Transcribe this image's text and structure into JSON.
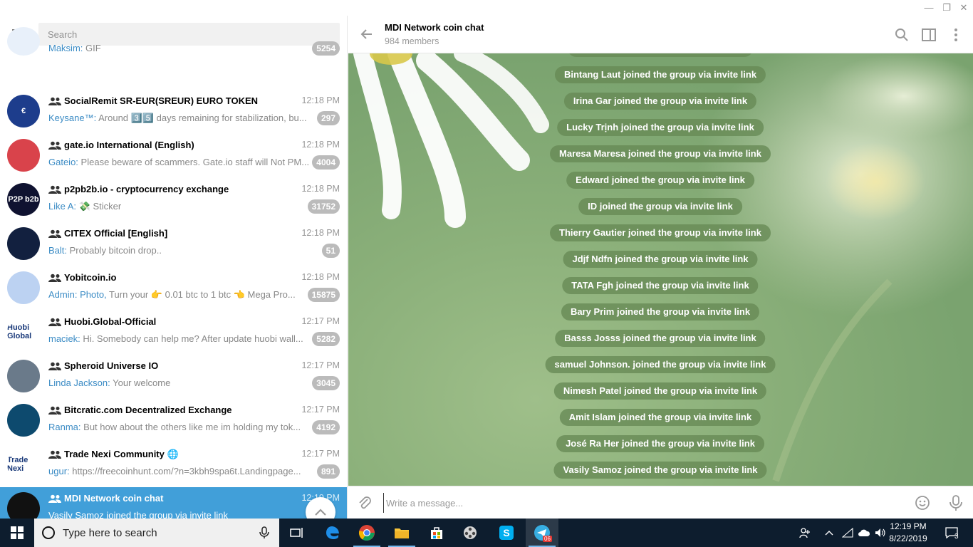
{
  "window": {
    "minimize": "—",
    "maximize": "❐",
    "close": "✕"
  },
  "sidebar": {
    "search_placeholder": "Search",
    "chats": [
      {
        "name": "",
        "sender": "Maksim:",
        "text": "GIF",
        "time": "",
        "badge": "5254",
        "avatar_color": "#e8f0fa",
        "avatar_text": "",
        "group": false
      },
      {
        "name": "SocialRemit SR-EUR(SREUR) EURO TOKEN",
        "sender": "Keysane™:",
        "text": "Around 3️⃣5️⃣ days remaining for stabilization, bu...",
        "time": "12:18 PM",
        "badge": "297",
        "avatar_color": "#1d3d8c",
        "avatar_text": "€",
        "group": true
      },
      {
        "name": "gate.io International (English)",
        "sender": "Gateio:",
        "text": "Please beware of scammers. Gate.io staff will Not PM...",
        "time": "12:18 PM",
        "badge": "4004",
        "avatar_color": "#d9434b",
        "avatar_text": "",
        "group": true
      },
      {
        "name": "p2pb2b.io - cryptocurrency exchange",
        "sender": "Like A:",
        "text": "💸 Sticker",
        "time": "12:18 PM",
        "badge": "31752",
        "avatar_color": "#0f1230",
        "avatar_text": "P2P b2b",
        "group": true
      },
      {
        "name": "CITEX Official [English]",
        "sender": "Balt:",
        "text": "Probably bitcoin drop..",
        "time": "12:18 PM",
        "badge": "51",
        "avatar_color": "#12203f",
        "avatar_text": "",
        "group": true
      },
      {
        "name": "Yobitcoin.io",
        "sender": "Admin: Photo,",
        "text": "Turn your 👉 0.01 btc to 1 btc 👈 Mega Pro...",
        "time": "12:18 PM",
        "badge": "15875",
        "avatar_color": "#bcd2f2",
        "avatar_text": "",
        "group": true
      },
      {
        "name": "Huobi.Global-Official",
        "sender": "maciek:",
        "text": "Hi. Somebody can help me? After update huobi wall...",
        "time": "12:17 PM",
        "badge": "5282",
        "avatar_color": "#ffffff",
        "avatar_text": "Huobi Global",
        "group": true
      },
      {
        "name": "Spheroid Universe IO",
        "sender": "Linda Jackson:",
        "text": "Your welcome",
        "time": "12:17 PM",
        "badge": "3045",
        "avatar_color": "#6a7a8a",
        "avatar_text": "",
        "group": true
      },
      {
        "name": "Bitcratic.com Decentralized Exchange",
        "sender": "Ranma:",
        "text": "But how about the others like me im holding my tok...",
        "time": "12:17 PM",
        "badge": "4192",
        "avatar_color": "#0d4a6e",
        "avatar_text": "",
        "group": true
      },
      {
        "name": "Trade Nexi Community 🌐",
        "sender": "ugur:",
        "text": "https://freecoinhunt.com/?n=3kbh9spa6t.Landingpage...",
        "time": "12:17 PM",
        "badge": "891",
        "avatar_color": "#ffffff",
        "avatar_text": "Trade Nexi",
        "group": true
      },
      {
        "name": "MDI Network coin chat",
        "sender": "",
        "text": "Vasily Samoz joined the group via invite link",
        "time": "12:19 PM",
        "badge": "",
        "avatar_color": "#111111",
        "avatar_text": "",
        "group": true
      }
    ]
  },
  "chat": {
    "title": "MDI Network coin chat",
    "subtitle": "984 members",
    "input_placeholder": "Write a message...",
    "service_messages": [
      "Bintang Laut joined the group via invite link",
      "Irina Gar joined the group via invite link",
      "Lucky Trịnh joined the group via invite link",
      "Maresa Maresa joined the group via invite link",
      "Edward joined the group via invite link",
      "ID joined the group via invite link",
      "Thierry Gautier joined the group via invite link",
      "Jdjf Ndfn joined the group via invite link",
      "TATA Fgh joined the group via invite link",
      "Bary Prim joined the group via invite link",
      "Basss Josss joined the group via invite link",
      "samuel Johnson. joined the group via invite link",
      "Nimesh Patel joined the group via invite link",
      "Amit Islam joined the group via invite link",
      "José Ra Her joined the group via invite link",
      "Vasily Samoz joined the group via invite link"
    ]
  },
  "taskbar": {
    "search_placeholder": "Type here to search",
    "time": "12:19 PM",
    "date": "8/22/2019",
    "notifications": "3",
    "telegram_badge": "06"
  }
}
